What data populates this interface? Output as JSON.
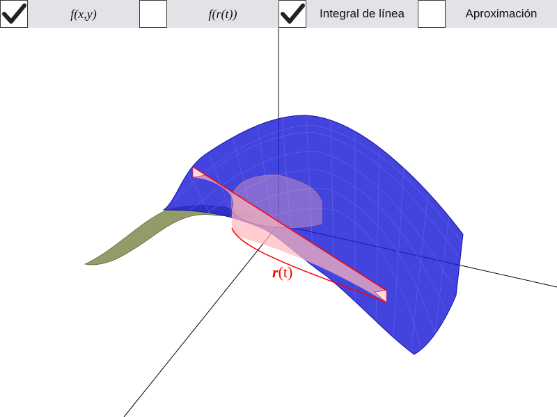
{
  "toolbar": {
    "options": [
      {
        "label": "f(x,y)",
        "checked": true
      },
      {
        "label": "f(r(t))",
        "checked": false
      },
      {
        "label": "Integral de línea",
        "checked": true
      },
      {
        "label": "Aproximación",
        "checked": false
      }
    ]
  },
  "scene": {
    "curve_label_bold": "r",
    "curve_label_rest": "(t)"
  },
  "colors": {
    "surface": "#1a1ad6",
    "surface_under": "#7f8b4f",
    "curve": "#ff0000",
    "curtain": "#ffb8bc",
    "axis": "#000000",
    "toolbar_bg": "#e1e3e6"
  }
}
